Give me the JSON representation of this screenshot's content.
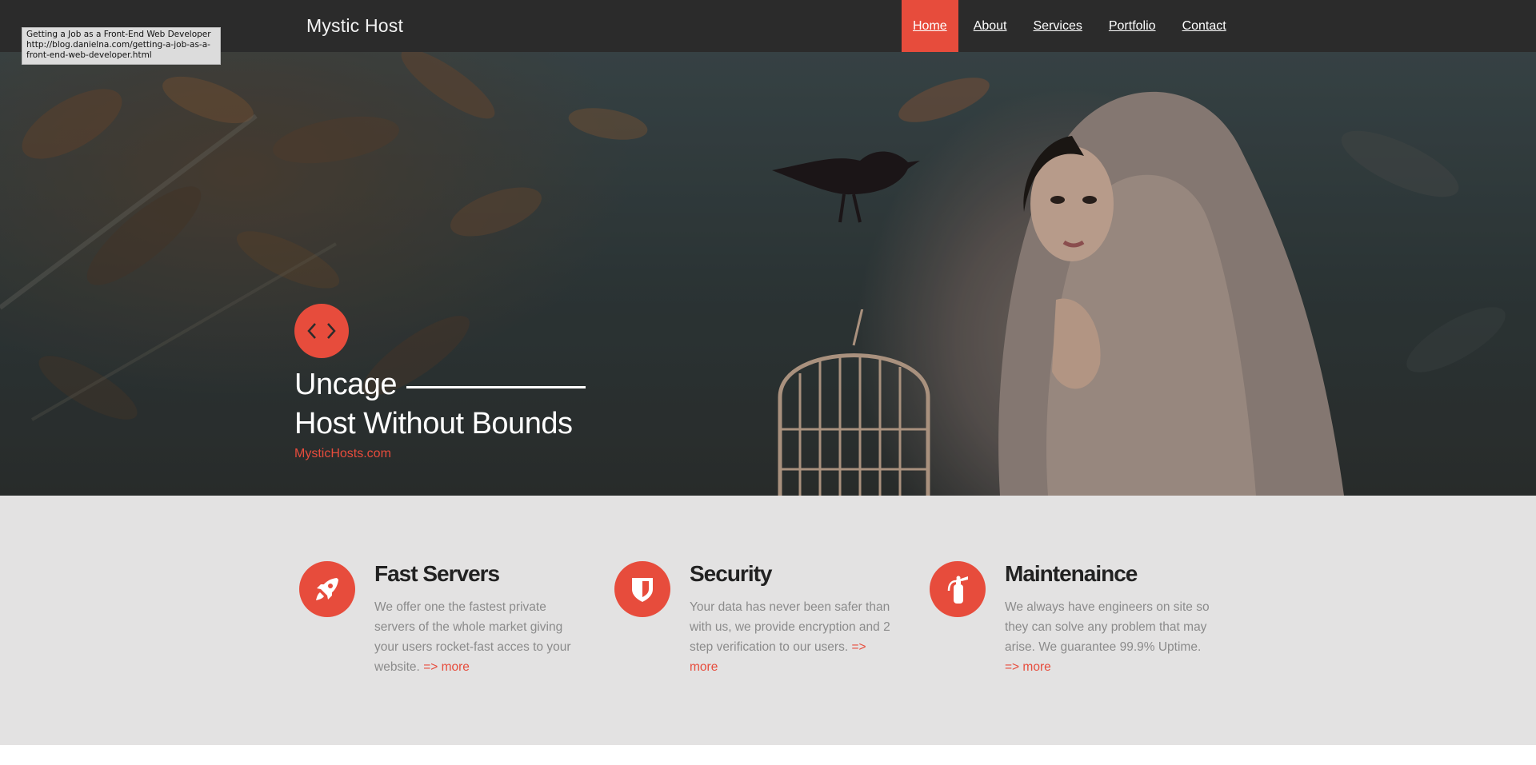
{
  "tooltip": {
    "title": "Getting a Job as a Front-End Web Developer",
    "url_line1": "http://blog.danielna.com/getting-a-job-as-a-",
    "url_line2": "front-end-web-developer.html"
  },
  "navbar": {
    "brand": "Mystic Host",
    "items": [
      {
        "label": "Home",
        "active": true
      },
      {
        "label": "About"
      },
      {
        "label": "Services"
      },
      {
        "label": "Portfolio"
      },
      {
        "label": "Contact"
      }
    ]
  },
  "hero": {
    "icon": "code-icon",
    "line1": "Uncage",
    "line2": "Host Without Bounds",
    "link": "MysticHosts.com"
  },
  "features": [
    {
      "icon": "rocket-icon",
      "title": "Fast Servers",
      "text": "We offer one the fastest private servers of the whole market giving your users rocket-fast acces to your website.",
      "more": "=> more"
    },
    {
      "icon": "shield-icon",
      "title": "Security",
      "text": "Your data has never been safer than with us, we provide encryption and 2 step verification to our users.",
      "more": "=> more"
    },
    {
      "icon": "fire-extinguisher-icon",
      "title": "Maintenaince",
      "text": "We always have engineers on site so they can solve any problem that may arise. We guarantee 99.9% Uptime.",
      "more": "=> more"
    }
  ],
  "colors": {
    "accent": "#e74c3c",
    "navbar": "#2b2b2b",
    "features_bg": "#e3e2e2"
  }
}
